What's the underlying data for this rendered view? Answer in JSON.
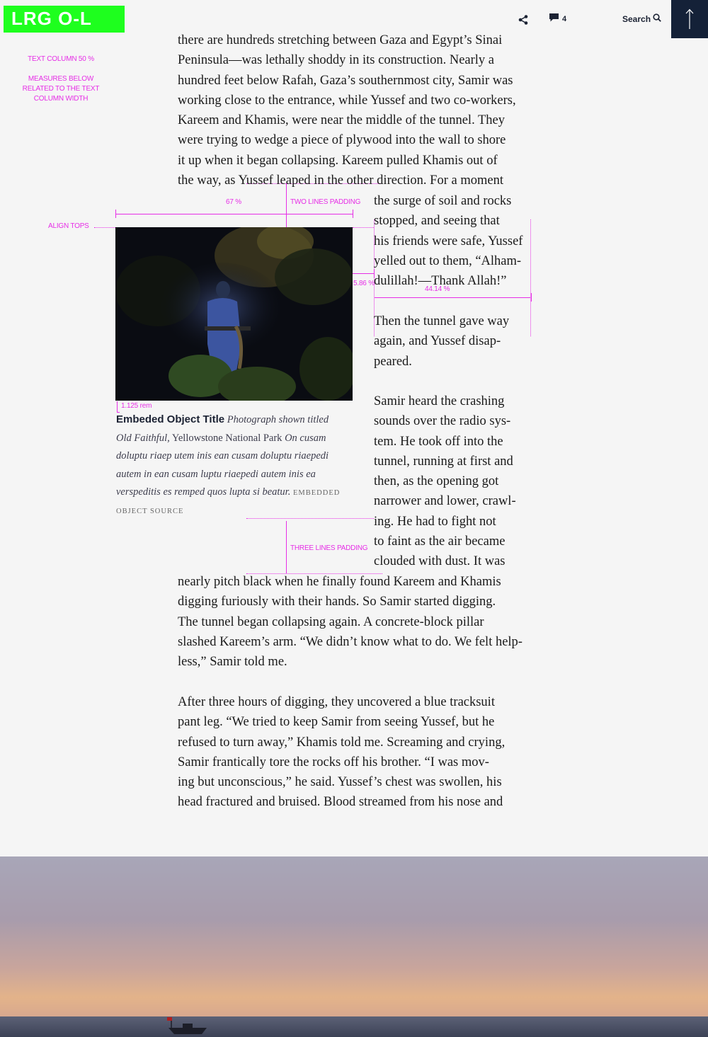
{
  "badge": "LRG O-L",
  "nav": {
    "comment_count": "4",
    "search_label": "Search"
  },
  "annotations": {
    "text_column": "TEXT COLUMN 50 %",
    "measures_note": [
      "MEASURES BELOW",
      "RELATED TO THE TEXT",
      "COLUMN WIDTH"
    ],
    "align_tops": "ALIGN TOPS",
    "pct_67": "67 %",
    "two_lines": "TWO LINES PADDING",
    "pct_586": "5.86 %",
    "pct_4414": "44.14 %",
    "rem": "1.125 rem",
    "three_lines": "THREE LINES PADDING"
  },
  "body": {
    "para1": [
      "there are hundreds stretching between Gaza and Egypt’s Sinai",
      "Peninsula—was lethally shoddy in its construction. Nearly a",
      "hundred feet below Rafah, Gaza’s southernmost city, Samir was",
      "working close to the entrance, while Yussef and two co-workers,",
      "Kareem and Khamis, were near the middle of the tunnel. They",
      "were trying to wedge a piece of plywood into the wall to shore",
      "it up when it began collapsing. Kareem pulled Khamis out of",
      "the way, as Yussef leaped in the other direction. For a moment"
    ],
    "para1_narrow": [
      "the surge of soil and rocks",
      "stopped, and seeing that",
      "his friends were safe, Yussef",
      "yelled out to them, “Alham-",
      "dulillah!—Thank Allah!”"
    ],
    "para2": [
      "Then the tunnel gave way",
      "again, and Yussef disap-",
      "peared."
    ],
    "para3_narrow": [
      "Samir heard the crashing",
      "sounds over the radio sys-",
      "tem. He took off into the",
      "tunnel, running at first and",
      "then, as the opening got",
      "narrower and lower, crawl-",
      "ing. He had to fight not",
      "to faint as the air became",
      "clouded with dust. It was"
    ],
    "para3_wide": [
      "nearly pitch black when he finally found Kareem and Khamis",
      "digging furiously with their hands. So Samir started digging.",
      "The tunnel began collapsing again. A concrete-block pillar",
      "slashed Kareem’s arm. “We didn’t know what to do. We felt help-",
      "less,” Samir told me."
    ],
    "para4": [
      "After three hours of digging, they uncovered a blue tracksuit",
      "pant leg. “We tried to keep Samir from seeing Yussef, but he",
      "refused to turn away,” Khamis told me. Screaming and crying,",
      "Samir frantically tore the rocks off his brother. “I was mov-",
      "ing but unconscious,” he said. Yussef’s chest was swollen, his",
      "head fractured and bruised. Blood streamed from his nose and"
    ]
  },
  "embed": {
    "title": "Embeded Object Title",
    "cap_line1_a": "Photograph shown titled",
    "cap_line2_a": "Old Faithful,",
    "cap_line2_b": "Yellowstone National Park",
    "cap_line2_c": "On cusam",
    "cap_line3": "doluptu riaep utem inis ean cusam doluptu riaepedi",
    "cap_line4": "autem in  ean cusam  luptu riaepedi autem inis ea",
    "cap_line5": "verspeditis es remped quos lupta si beatur.",
    "source_a": "EMBEDDED",
    "source_b": "OBJECT SOURCE"
  },
  "colors": {
    "badge": "#1eff1e",
    "annotation": "#e62ee6",
    "nav_dark": "#142138"
  },
  "icons": [
    "share-icon",
    "comment-icon",
    "search-icon",
    "arrow-up-icon"
  ]
}
